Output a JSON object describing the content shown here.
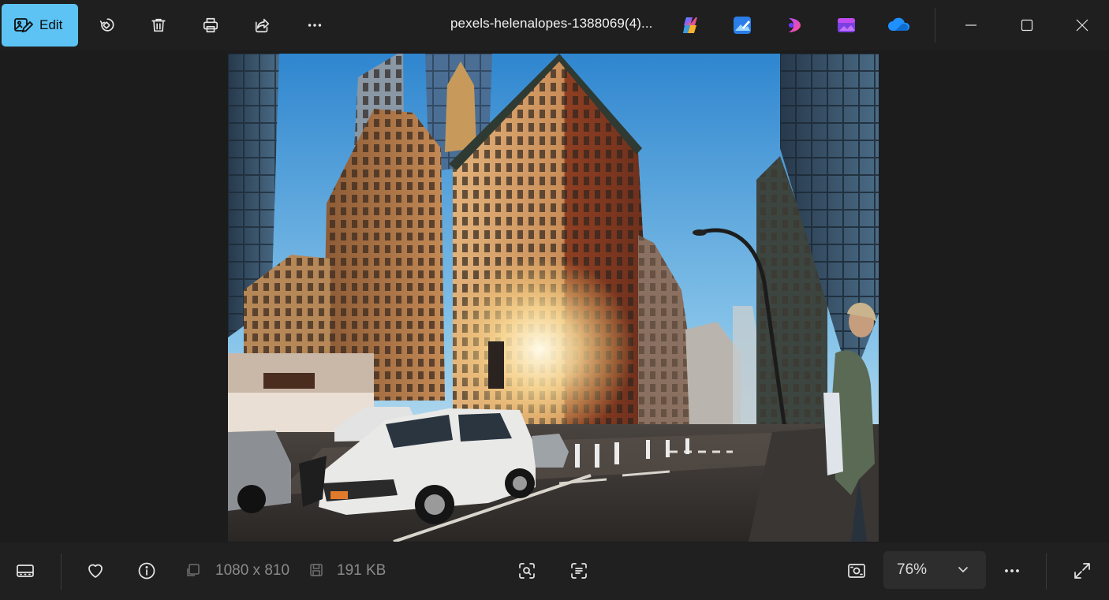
{
  "toolbar": {
    "edit_label": "Edit",
    "filename": "pexels-helenalopes-1388069(4)...",
    "icons": [
      "edit-image-icon",
      "rotate-icon",
      "delete-icon",
      "print-icon",
      "share-icon",
      "more-icon"
    ]
  },
  "app_icons": [
    "copilot-icon",
    "photos-editor-icon",
    "clipchamp-icon",
    "designer-icon",
    "onedrive-icon"
  ],
  "window_controls": [
    "minimize-icon",
    "maximize-icon",
    "close-icon"
  ],
  "image": {
    "description_colors": {
      "sky": "#5aaee0",
      "building": "#b77a4a",
      "car": "#e8e8e6",
      "road": "#2f2d2c"
    }
  },
  "bottombar": {
    "dimensions": "1080 x 810",
    "file_size": "191 KB",
    "zoom": "76%"
  },
  "colors": {
    "accent": "#5cc3f4",
    "background": "#1c1c1c",
    "toolbar": "#1f1f1f"
  }
}
